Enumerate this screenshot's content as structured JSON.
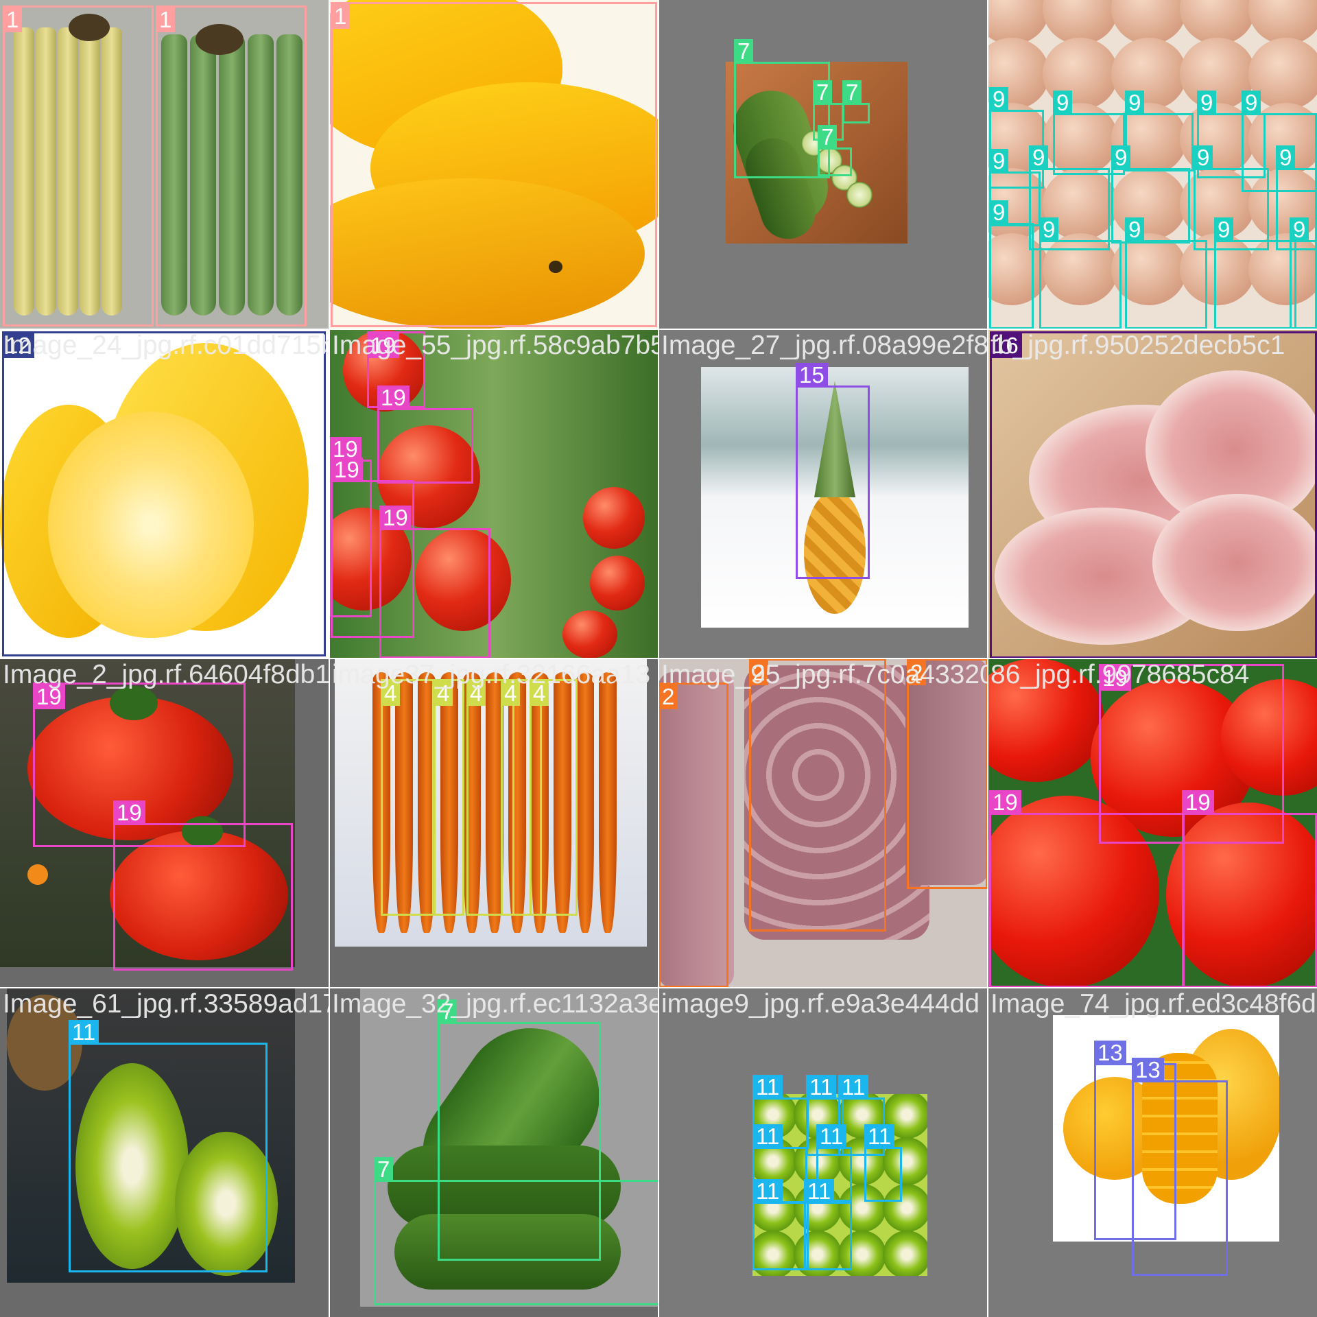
{
  "mosaic": {
    "tiles": [
      {
        "id": "t00",
        "filename": "",
        "bg": "#a9a9a5",
        "photo": "banana-bunches",
        "boxes": [
          {
            "label": "1",
            "color": "#ff9f9f"
          },
          {
            "label": "1",
            "color": "#ff9f9f"
          }
        ]
      },
      {
        "id": "t01",
        "filename": "",
        "bg": "#f6f2e6",
        "photo": "banana-closeup",
        "boxes": [
          {
            "label": "1",
            "color": "#ff9f9f"
          }
        ]
      },
      {
        "id": "t02",
        "filename": "",
        "bg": "#7a7a7a",
        "photo": "cucumber-board",
        "boxes": [
          {
            "label": "7",
            "color": "#3ddb86"
          },
          {
            "label": "7",
            "color": "#3ddb86"
          },
          {
            "label": "7",
            "color": "#3ddb86"
          },
          {
            "label": "7",
            "color": "#3ddb86"
          }
        ]
      },
      {
        "id": "t03",
        "filename": "",
        "bg": "#e9d8cc",
        "photo": "egg-tray",
        "boxes": [
          {
            "label": "9",
            "color": "#1ad1c1"
          },
          {
            "label": "9",
            "color": "#1ad1c1"
          },
          {
            "label": "9",
            "color": "#1ad1c1"
          },
          {
            "label": "9",
            "color": "#1ad1c1"
          },
          {
            "label": "9",
            "color": "#1ad1c1"
          },
          {
            "label": "9",
            "color": "#1ad1c1"
          },
          {
            "label": "9",
            "color": "#1ad1c1"
          },
          {
            "label": "9",
            "color": "#1ad1c1"
          },
          {
            "label": "9",
            "color": "#1ad1c1"
          },
          {
            "label": "9",
            "color": "#1ad1c1"
          },
          {
            "label": "9",
            "color": "#1ad1c1"
          },
          {
            "label": "9",
            "color": "#1ad1c1"
          },
          {
            "label": "9",
            "color": "#1ad1c1"
          },
          {
            "label": "9",
            "color": "#1ad1c1"
          },
          {
            "label": "9",
            "color": "#1ad1c1"
          }
        ]
      },
      {
        "id": "t10",
        "filename": "Image_24_jpg.rf.c01dd715b",
        "bg": "#ffffff",
        "photo": "lemons",
        "boxes": [
          {
            "label": "12",
            "color": "#33408f"
          }
        ]
      },
      {
        "id": "t11",
        "filename": "Image_55_jpg.rf.58c9ab7b5",
        "bg": "#5a8a3a",
        "photo": "tomatoes-vine",
        "boxes": [
          {
            "label": "19",
            "color": "#e846c7"
          },
          {
            "label": "19",
            "color": "#e846c7"
          },
          {
            "label": "19",
            "color": "#e846c7"
          },
          {
            "label": "19",
            "color": "#e846c7"
          },
          {
            "label": "19",
            "color": "#e846c7"
          }
        ]
      },
      {
        "id": "t12",
        "filename": "Image_27_jpg.rf.08a99e2f864",
        "bg": "#7a7a7a",
        "photo": "pineapple",
        "boxes": [
          {
            "label": "15",
            "color": "#8e4ee6"
          }
        ]
      },
      {
        "id": "t13",
        "filename": "fb_jpg.rf.950252decb5c1",
        "bg": "#d9b896",
        "photo": "pork-slices",
        "boxes": [
          {
            "label": "16",
            "color": "#52107a"
          }
        ]
      },
      {
        "id": "t20",
        "filename": "Image_2_jpg.rf.64604f8db1",
        "bg": "#6a6a6a",
        "photo": "heirloom-tomatoes",
        "boxes": [
          {
            "label": "19",
            "color": "#e846c7"
          },
          {
            "label": "19",
            "color": "#e846c7"
          }
        ]
      },
      {
        "id": "t21",
        "filename": "image37_jpg.rf.32166aa13",
        "bg": "#6a6a6a",
        "photo": "carrots",
        "boxes": [
          {
            "label": "4",
            "color": "#cfdc4b"
          },
          {
            "label": "4",
            "color": "#cfdc4b"
          },
          {
            "label": "4",
            "color": "#cfdc4b"
          },
          {
            "label": "4",
            "color": "#cfdc4b"
          },
          {
            "label": "4",
            "color": "#cfdc4b"
          }
        ]
      },
      {
        "id": "t22",
        "filename": "Image_95_jpg.rf.7c0a43320b",
        "bg": "#c7bdb8",
        "photo": "beef",
        "boxes": [
          {
            "label": "2",
            "color": "#f57424"
          },
          {
            "label": "2",
            "color": "#f57424"
          },
          {
            "label": "2",
            "color": "#f57424"
          }
        ]
      },
      {
        "id": "t23",
        "filename": "86_jpg.rf.9978685c84",
        "bg": "#2b6b25",
        "photo": "tomatoes-leaves",
        "boxes": [
          {
            "label": "19",
            "color": "#e846c7"
          },
          {
            "label": "19",
            "color": "#e846c7"
          },
          {
            "label": "19",
            "color": "#e846c7"
          }
        ]
      },
      {
        "id": "t30",
        "filename": "Image_61_jpg.rf.33589ad17f",
        "bg": "#6a6a6a",
        "photo": "kiwi-halves",
        "boxes": [
          {
            "label": "11",
            "color": "#1bb6ee"
          }
        ]
      },
      {
        "id": "t31",
        "filename": "Image_32_jpg.rf.ec1132a3e5",
        "bg": "#6a6a6a",
        "photo": "cucumbers-white",
        "boxes": [
          {
            "label": "7",
            "color": "#3ddb86"
          },
          {
            "label": "7",
            "color": "#3ddb86"
          }
        ]
      },
      {
        "id": "t32",
        "filename": "image9_jpg.rf.e9a3e444dd",
        "bg": "#7a7a7a",
        "photo": "kiwi-slices",
        "boxes": [
          {
            "label": "11",
            "color": "#1bb6ee"
          },
          {
            "label": "11",
            "color": "#1bb6ee"
          },
          {
            "label": "11",
            "color": "#1bb6ee"
          },
          {
            "label": "11",
            "color": "#1bb6ee"
          },
          {
            "label": "11",
            "color": "#1bb6ee"
          },
          {
            "label": "11",
            "color": "#1bb6ee"
          },
          {
            "label": "11",
            "color": "#1bb6ee"
          },
          {
            "label": "11",
            "color": "#1bb6ee"
          }
        ]
      },
      {
        "id": "t33",
        "filename": "Image_74_jpg.rf.ed3c48f6d",
        "bg": "#7a7a7a",
        "photo": "mangoes",
        "boxes": [
          {
            "label": "13",
            "color": "#6f6fe6"
          },
          {
            "label": "13",
            "color": "#6f6fe6"
          }
        ]
      }
    ]
  }
}
